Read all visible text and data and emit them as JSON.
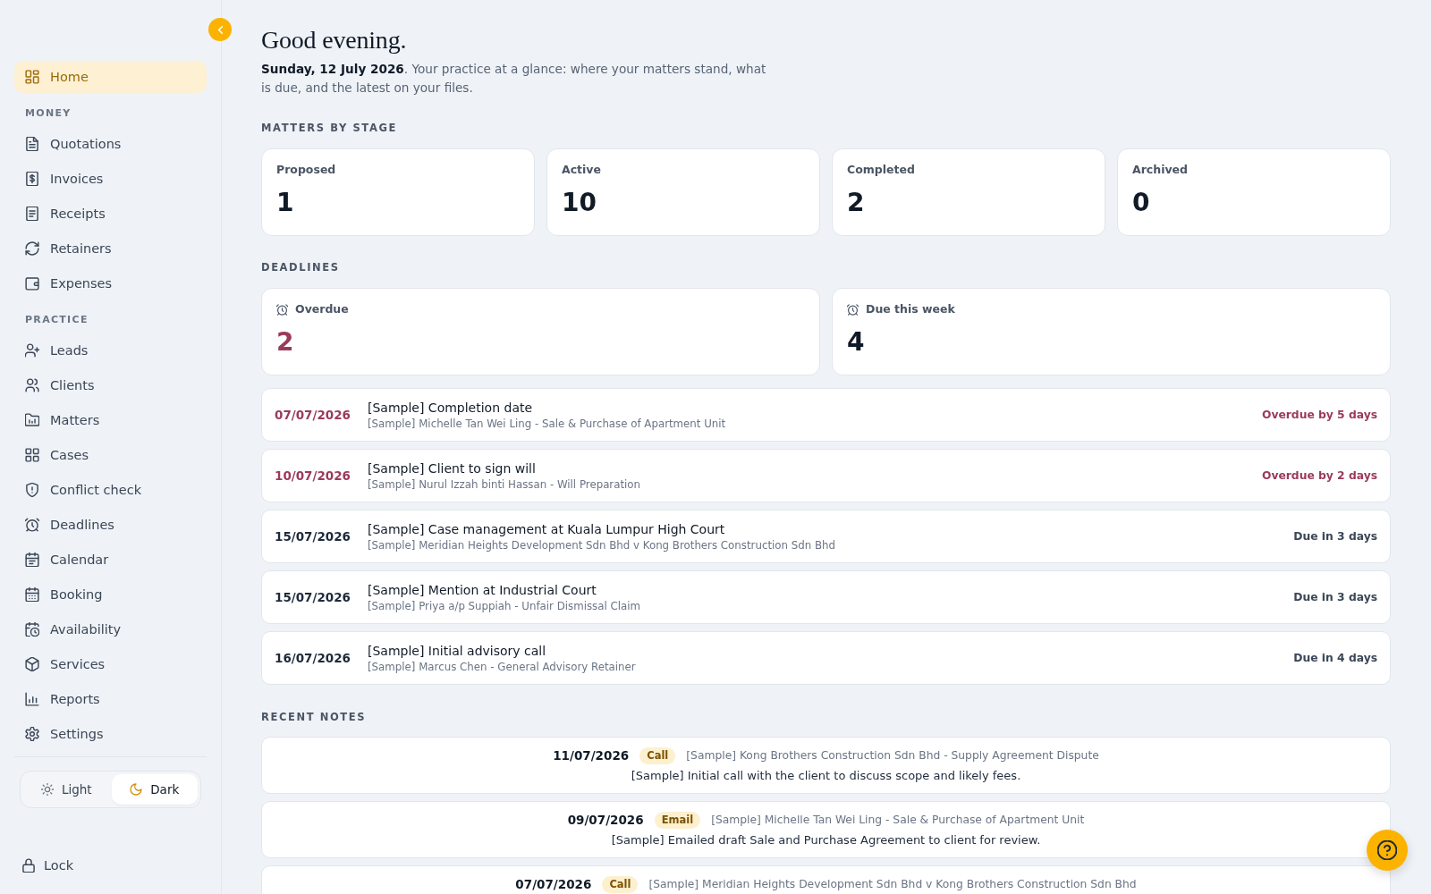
{
  "sidebar": {
    "groups": [
      {
        "items": [
          {
            "label": "Home",
            "selected": true
          }
        ]
      },
      {
        "heading": "MONEY",
        "items": [
          {
            "label": "Quotations",
            "selected": false
          },
          {
            "label": "Invoices",
            "selected": false
          },
          {
            "label": "Receipts",
            "selected": false
          },
          {
            "label": "Retainers",
            "selected": false
          },
          {
            "label": "Expenses",
            "selected": false
          }
        ]
      },
      {
        "heading": "PRACTICE",
        "items": [
          {
            "label": "Leads",
            "selected": false
          },
          {
            "label": "Clients",
            "selected": false
          },
          {
            "label": "Matters",
            "selected": false
          },
          {
            "label": "Cases",
            "selected": false
          },
          {
            "label": "Conflict check",
            "selected": false
          },
          {
            "label": "Deadlines",
            "selected": false
          },
          {
            "label": "Calendar",
            "selected": false
          },
          {
            "label": "Booking",
            "selected": false
          },
          {
            "label": "Availability",
            "selected": false
          },
          {
            "label": "Services",
            "selected": false
          },
          {
            "label": "Reports",
            "selected": false
          },
          {
            "label": "Settings",
            "selected": false
          }
        ]
      }
    ],
    "theme_toggle": {
      "options": [
        {
          "label": "Light",
          "selected": false
        },
        {
          "label": "Dark",
          "selected": true
        }
      ]
    },
    "lock": "Lock"
  },
  "main": {
    "greeting": "Good evening.",
    "intro": "**Sunday, 12 July 2026**. Your practice at a glance: where your matters stand, what is due, and the latest on your files.",
    "matters_by_stage": {
      "heading": "MATTERS BY STAGE",
      "cards": [
        {
          "label": "Proposed",
          "count": "1"
        },
        {
          "label": "Active",
          "count": "10"
        },
        {
          "label": "Completed",
          "count": "2"
        },
        {
          "label": "Archived",
          "count": "0"
        }
      ]
    },
    "deadlines": {
      "heading": "DEADLINES",
      "summary": [
        {
          "label": "Overdue",
          "count": "2",
          "overdue": true
        },
        {
          "label": "Due this week",
          "count": "4",
          "overdue": false
        }
      ],
      "items": [
        {
          "date": "07/07/2026",
          "title": "[Sample] Completion date",
          "matter": "[Sample] Michelle Tan Wei Ling - Sale & Purchase of Apartment Unit",
          "status": "Overdue by 5 days",
          "overdue": true
        },
        {
          "date": "10/07/2026",
          "title": "[Sample] Client to sign will",
          "matter": "[Sample] Nurul Izzah binti Hassan - Will Preparation",
          "status": "Overdue by 2 days",
          "overdue": true
        },
        {
          "date": "15/07/2026",
          "title": "[Sample] Case management at Kuala Lumpur High Court",
          "matter": "[Sample] Meridian Heights Development Sdn Bhd v Kong Brothers Construction Sdn Bhd",
          "status": "Due in 3 days",
          "overdue": false
        },
        {
          "date": "15/07/2026",
          "title": "[Sample] Mention at Industrial Court",
          "matter": "[Sample] Priya a/p Suppiah - Unfair Dismissal Claim",
          "status": "Due in 3 days",
          "overdue": false
        },
        {
          "date": "16/07/2026",
          "title": "[Sample] Initial advisory call",
          "matter": "[Sample] Marcus Chen - General Advisory Retainer",
          "status": "Due in 4 days",
          "overdue": false
        }
      ]
    },
    "recent_notes": {
      "heading": "RECENT NOTES",
      "items": [
        {
          "date": "11/07/2026",
          "type": "Call",
          "matter": "[Sample] Kong Brothers Construction Sdn Bhd - Supply Agreement Dispute",
          "text": "[Sample] Initial call with the client to discuss scope and likely fees."
        },
        {
          "date": "09/07/2026",
          "type": "Email",
          "matter": "[Sample] Michelle Tan Wei Ling - Sale & Purchase of Apartment Unit",
          "text": "[Sample] Emailed draft Sale and Purchase Agreement to client for review."
        },
        {
          "date": "07/07/2026",
          "type": "Call",
          "matter": "[Sample] Meridian Heights Development Sdn Bhd v Kong Brothers Construction Sdn Bhd"
        }
      ]
    }
  }
}
